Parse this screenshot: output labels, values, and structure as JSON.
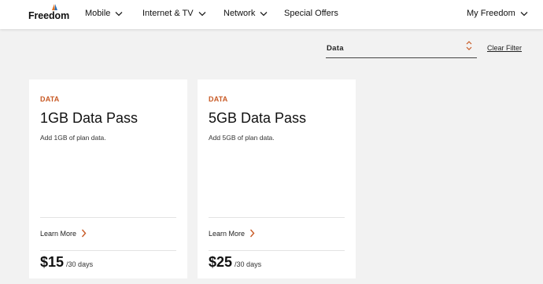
{
  "header": {
    "logo_text": "Freedom",
    "nav": [
      {
        "label": "Mobile"
      },
      {
        "label": "Internet & TV"
      },
      {
        "label": "Network"
      },
      {
        "label": "Special Offers"
      }
    ],
    "account_label": "My Freedom"
  },
  "filter": {
    "selected_value": "Data",
    "clear_label": "Clear Filter"
  },
  "cards": [
    {
      "category": "DATA",
      "title": "1GB Data Pass",
      "description": "Add 1GB of plan data.",
      "learn_more": "Learn More",
      "price": "$15",
      "period": "/30 days"
    },
    {
      "category": "DATA",
      "title": "5GB Data Pass",
      "description": "Add 5GB of plan data.",
      "learn_more": "Learn More",
      "price": "$25",
      "period": "/30 days"
    }
  ],
  "colors": {
    "accent": "#c85a25",
    "logo_orange": "#e8741e",
    "logo_blue": "#2a6fb5",
    "background": "#f2f2f2",
    "card": "#ffffff"
  },
  "icons": {
    "nav_chevron": "chevron-down-icon",
    "filter_arrows": "sort-arrows-icon",
    "learn_more_arrow": "chevron-right-icon"
  }
}
